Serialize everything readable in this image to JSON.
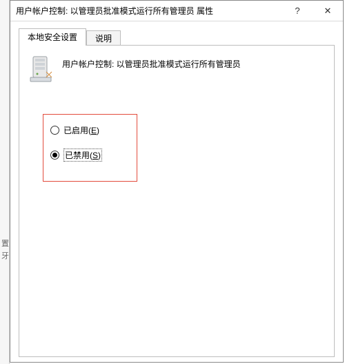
{
  "window": {
    "title": "用户帐户控制: 以管理员批准模式运行所有管理员 属性",
    "help_glyph": "?",
    "close_glyph": "✕"
  },
  "tabs": {
    "local_security": "本地安全设置",
    "explain": "说明"
  },
  "panel": {
    "policy_label": "用户帐户控制: 以管理员批准模式运行所有管理员"
  },
  "options": {
    "enabled_prefix": "已启用(",
    "enabled_key": "E",
    "enabled_suffix": ")",
    "disabled_prefix": "已禁用(",
    "disabled_key": "S",
    "disabled_suffix": ")",
    "selected": "disabled"
  },
  "left_edge": {
    "t1": "置",
    "t2": "牙"
  }
}
